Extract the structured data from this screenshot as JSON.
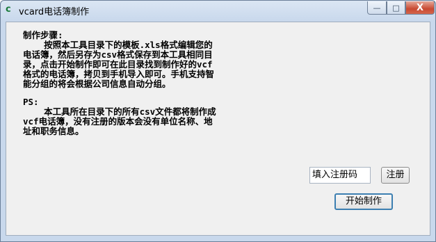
{
  "window": {
    "title": "vcard电话簿制作",
    "controls": {
      "minimize": "—",
      "maximize": "□",
      "close": "X"
    }
  },
  "content": {
    "steps_heading": "制作步骤:",
    "steps_lines": [
      "    按照本工具目录下的模板.xls格式编辑您的",
      "电话簿，然后另存为csv格式保存到本工具相同目",
      "录，点击开始制作即可在此目录找到制作好的vcf",
      "格式的电话簿，拷贝到手机导入即可。手机支持智",
      "能分组的将会根据公司信息自动分组。"
    ],
    "ps_heading": "PS:",
    "ps_lines": [
      "    本工具所在目录下的所有csv文件都将制作成",
      "vcf电话簿，没有注册的版本会没有单位名称、地",
      "址和职务信息。"
    ]
  },
  "registration": {
    "code_value": "填入注册码",
    "register_label": "注册"
  },
  "actions": {
    "start_label": "开始制作"
  }
}
